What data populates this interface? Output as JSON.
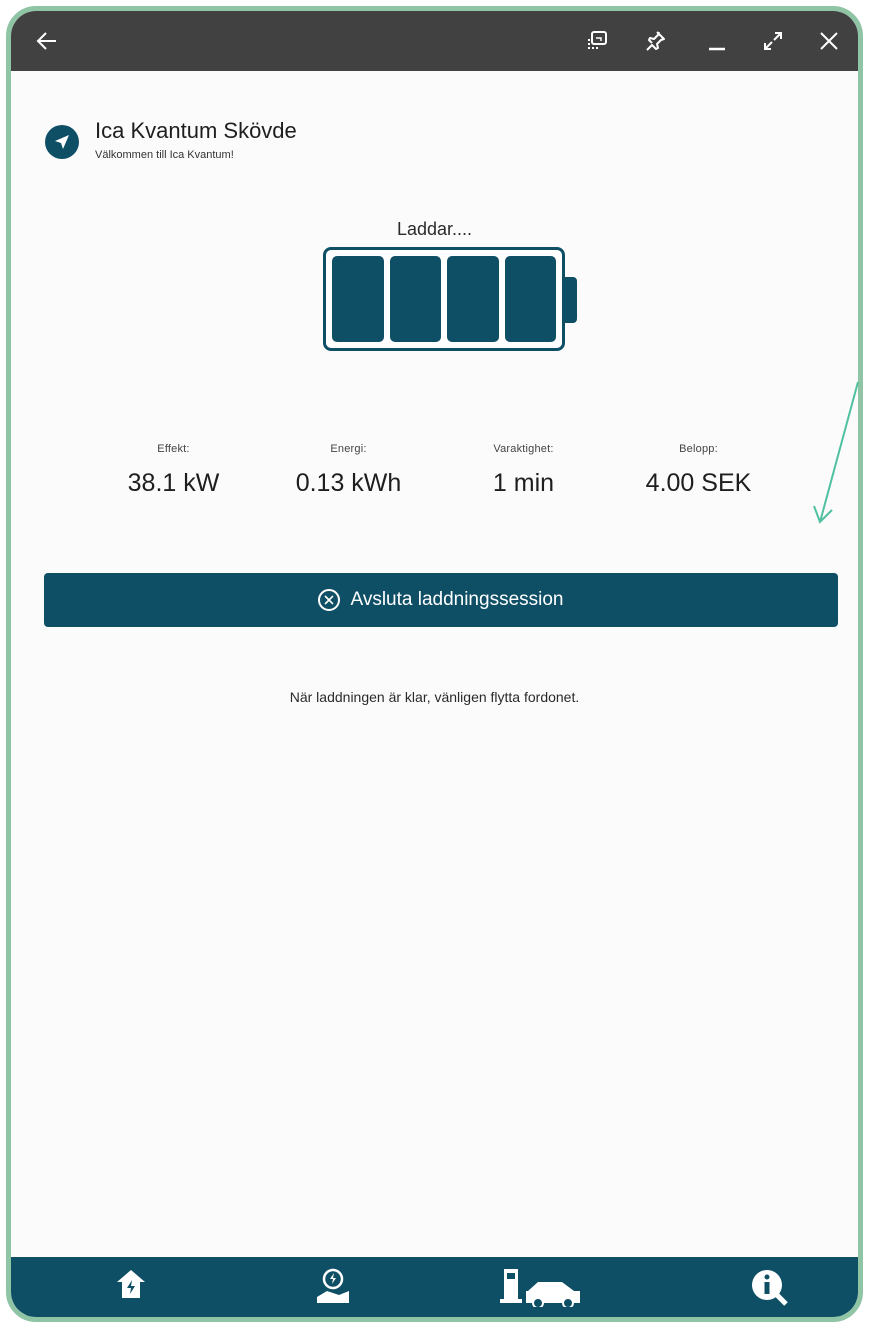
{
  "colors": {
    "frame_border": "#8fc4a4",
    "titlebar": "#414141",
    "accent": "#0e4f66",
    "background": "#fbfbfb",
    "annotation_arrow": "#4fc0a0"
  },
  "titlebar": {
    "icons": [
      "back-arrow-icon",
      "screenshot-icon",
      "pin-icon",
      "minimize-icon",
      "expand-icon",
      "close-icon"
    ]
  },
  "header": {
    "icon": "location-arrow-icon",
    "title": "Ica Kvantum Skövde",
    "subtitle": "Välkommen till Ica Kvantum!"
  },
  "charging": {
    "status": "Laddar....",
    "battery_level": 1.0,
    "battery_cells_filled": 4
  },
  "stats": [
    {
      "label": "Effekt:",
      "value": "38.1 kW"
    },
    {
      "label": "Energi:",
      "value": "0.13 kWh"
    },
    {
      "label": "Varaktighet:",
      "value": "1 min"
    },
    {
      "label": "Belopp:",
      "value": "4.00 SEK"
    }
  ],
  "end_session_button": {
    "icon": "circle-x-icon",
    "label": "Avsluta laddningssession"
  },
  "note": "När laddningen är klar, vänligen flytta fordonet.",
  "bottom_nav": {
    "items": [
      {
        "icon": "home-charger-icon"
      },
      {
        "icon": "map-charging-location-icon"
      },
      {
        "icon": "charging-car-icon"
      },
      {
        "icon": "info-search-icon"
      }
    ]
  }
}
